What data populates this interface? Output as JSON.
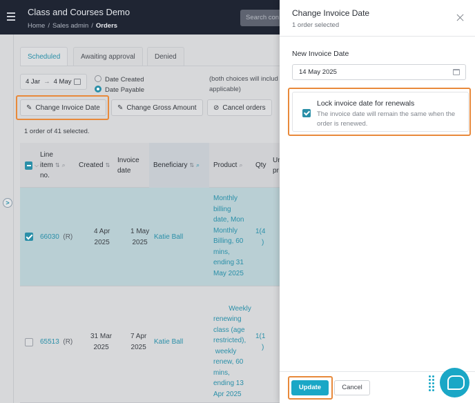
{
  "header": {
    "app_title": "Class and Courses Demo",
    "breadcrumbs": [
      "Home",
      "Sales admin",
      "Orders"
    ],
    "search_placeholder": "Search con"
  },
  "tabs": [
    {
      "label": "Scheduled",
      "active": true
    },
    {
      "label": "Awaiting approval",
      "active": false
    },
    {
      "label": "Denied",
      "active": false
    }
  ],
  "filters": {
    "date_from": "4 Jar",
    "date_to": "4 May",
    "radio_created": "Date Created",
    "radio_payable": "Date Payable",
    "selected_radio": "Date Payable",
    "note_line1": "(both choices will includ",
    "note_line2": "applicable)"
  },
  "actions": {
    "change_invoice_date": "Change Invoice Date",
    "change_gross_amount": "Change Gross Amount",
    "cancel_orders": "Cancel orders"
  },
  "selection_text": "1 order of 41 selected.",
  "table": {
    "columns": {
      "line_item": [
        "Line",
        "item",
        "no."
      ],
      "created": "Created",
      "invoice_date": [
        "Invoice",
        "date"
      ],
      "beneficiary": "Beneficiary",
      "product": "Product",
      "qty": "Qty",
      "unit_price": [
        "Ur",
        "pr"
      ]
    },
    "rows": [
      {
        "checked": true,
        "line_item": "66030",
        "tag": "(R)",
        "created": [
          "4 Apr",
          "2025"
        ],
        "invoice_date": [
          "1 May",
          "2025"
        ],
        "beneficiary": "Katie Ball",
        "product": [
          "Monthly",
          "billing",
          "date, Mon",
          "Monthly",
          "Billing, 60",
          "mins,",
          "ending 31",
          "May 2025"
        ],
        "qty": [
          "1(4",
          ")"
        ]
      },
      {
        "checked": false,
        "line_item": "65513",
        "tag": "(R)",
        "created": [
          "31 Mar",
          "2025"
        ],
        "invoice_date": [
          "7 Apr",
          "2025"
        ],
        "beneficiary": "Katie Ball",
        "product": [
          "Weekly",
          "renewing",
          "class (age",
          "restricted),",
          " weekly",
          "renew, 60",
          "mins,",
          "ending 13",
          "Apr 2025"
        ],
        "qty": [
          "1(1",
          ")"
        ]
      }
    ]
  },
  "panel": {
    "title": "Change Invoice Date",
    "subtitle": "1 order selected",
    "field_label": "New Invoice Date",
    "date_value": "14 May 2025",
    "lock_title": "Lock invoice date for renewals",
    "lock_desc": "The invoice date will remain the same when the order is renewed.",
    "lock_checked": true,
    "update_label": "Update",
    "cancel_label": "Cancel"
  },
  "colors": {
    "accent": "#1aa7c6",
    "highlight": "#e8893a",
    "header_bg": "#1f2533"
  }
}
